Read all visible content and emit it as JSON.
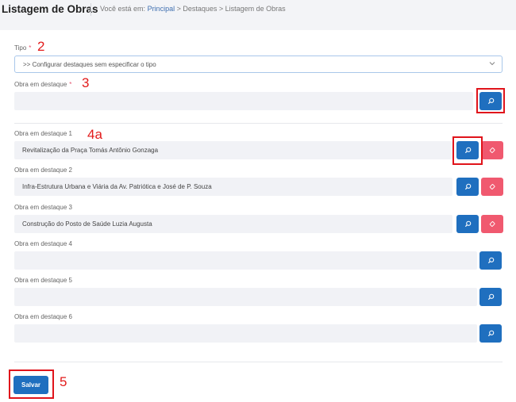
{
  "header": {
    "title": "Listagem de Obras",
    "breadcrumb_prefix": "Você está em:",
    "breadcrumb_link": "Principal",
    "breadcrumb_rest": " > Destaques > Listagem de Obras"
  },
  "form": {
    "tipo_label": "Tipo",
    "required_mark": "*",
    "tipo_value": ">> Configurar destaques sem especificar o tipo",
    "obra_label": "Obra em destaque",
    "obra_value": ""
  },
  "items": [
    {
      "label": "Obra em destaque 1",
      "value": "Revitalização da Praça Tomás Antônio Gonzaga"
    },
    {
      "label": "Obra em destaque 2",
      "value": "Infra-Estrutura Urbana e Viária da Av. Patriótica e José de P. Souza"
    },
    {
      "label": "Obra em destaque 3",
      "value": "Construção do Posto de Saúde Luzia Augusta"
    },
    {
      "label": "Obra em destaque 4",
      "value": ""
    },
    {
      "label": "Obra em destaque 5",
      "value": ""
    },
    {
      "label": "Obra em destaque 6",
      "value": ""
    }
  ],
  "annotations": {
    "a2": "2",
    "a3": "3",
    "a4a": "4a",
    "a5": "5"
  },
  "buttons": {
    "save_label": "Salvar"
  },
  "icons": {
    "search": "search-icon",
    "erase": "eraser-icon",
    "chevron": "chevron-down-icon"
  },
  "colors": {
    "primary": "#1f6fbf",
    "danger": "#f0596f",
    "annotation": "#e0141b"
  }
}
